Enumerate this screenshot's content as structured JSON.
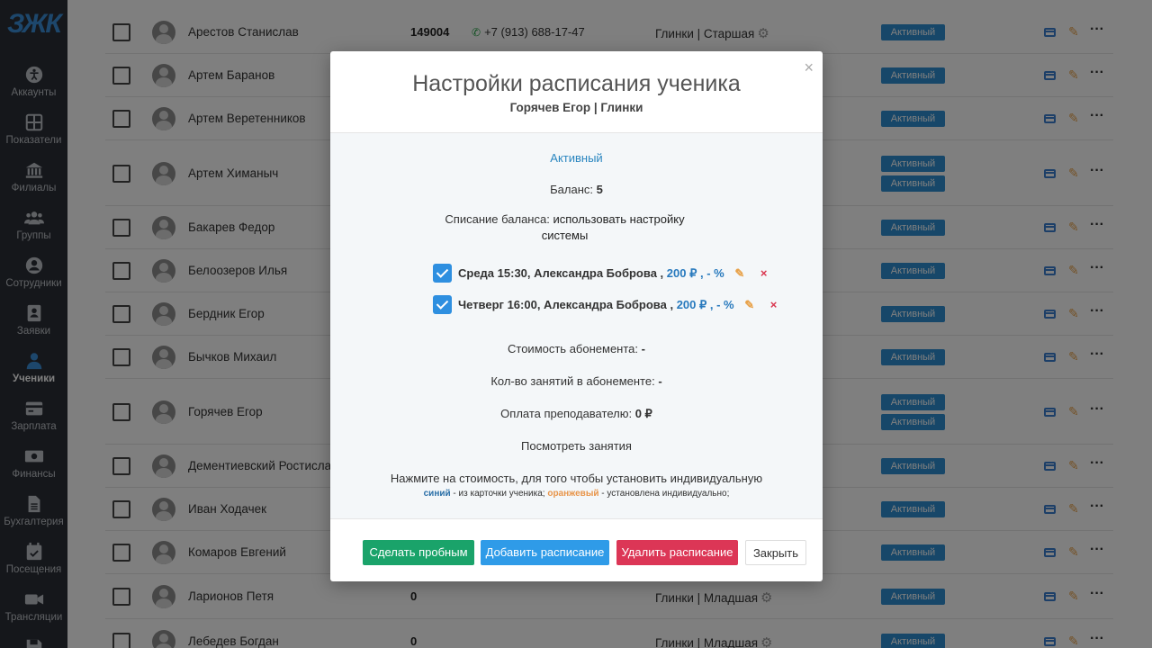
{
  "sidebar": {
    "logo": "ЗЖК",
    "items": [
      {
        "label": "Аккаунты",
        "icon": "accessibility-icon"
      },
      {
        "label": "Показатели",
        "icon": "grid-icon"
      },
      {
        "label": "Филиалы",
        "icon": "bank-icon"
      },
      {
        "label": "Группы",
        "icon": "users-icon"
      },
      {
        "label": "Сотрудники",
        "icon": "user-circle-icon"
      },
      {
        "label": "Заявки",
        "icon": "contact-card-icon"
      },
      {
        "label": "Ученики",
        "icon": "user-icon"
      },
      {
        "label": "Зарплата",
        "icon": "credit-card-icon"
      },
      {
        "label": "Финансы",
        "icon": "money-icon"
      },
      {
        "label": "Бухгалтерия",
        "icon": "document-icon"
      },
      {
        "label": "Посещения",
        "icon": "calendar-check-icon"
      },
      {
        "label": "Трансляции",
        "icon": "video-icon"
      },
      {
        "label": "",
        "icon": "save-icon"
      }
    ]
  },
  "table": {
    "rows": [
      {
        "name": "Арестов Станислав",
        "code": "149004",
        "phone": "+7 (913) 688-17-47",
        "group": "Глинки | Старшая",
        "statuses": [
          "Активный"
        ]
      },
      {
        "name": "Артем Баранов",
        "code": "",
        "phone": "",
        "group": "",
        "statuses": [
          "Активный"
        ]
      },
      {
        "name": "Артем Веретенников",
        "code": "",
        "phone": "",
        "group": "",
        "statuses": [
          "Активный"
        ]
      },
      {
        "name": "Артем Химаныч",
        "code": "",
        "phone": "",
        "group": "",
        "statuses": [
          "Активный",
          "Активный"
        ]
      },
      {
        "name": "Бакарев Федор",
        "code": "",
        "phone": "",
        "group": "",
        "statuses": [
          "Активный"
        ]
      },
      {
        "name": "Белоозеров Илья",
        "code": "",
        "phone": "",
        "group": "",
        "statuses": [
          "Активный"
        ]
      },
      {
        "name": "Бердник Егор",
        "code": "",
        "phone": "",
        "group": "",
        "statuses": [
          "Активный"
        ]
      },
      {
        "name": "Бычков Михаил",
        "code": "",
        "phone": "",
        "group": "",
        "statuses": [
          "Активный"
        ]
      },
      {
        "name": "Горячев Егор",
        "code": "",
        "phone": "",
        "group": "",
        "statuses": [
          "Активный",
          "Активный"
        ]
      },
      {
        "name": "Дементиевский Ростислав",
        "code": "",
        "phone": "",
        "group": "",
        "statuses": [
          "Активный"
        ]
      },
      {
        "name": "Иван Ходачек",
        "code": "",
        "phone": "",
        "group": "",
        "statuses": [
          "Активный"
        ]
      },
      {
        "name": "Комаров Евгений",
        "code": "",
        "phone": "",
        "group": "",
        "statuses": [
          "Активный"
        ]
      },
      {
        "name": "Ларионов Петя",
        "code": "0",
        "phone": "",
        "group": "Глинки | Младшая",
        "statuses": [
          "Активный"
        ]
      },
      {
        "name": "Лебедев Богдан",
        "code": "0",
        "phone": "",
        "group": "Глинки | Младшая",
        "statuses": [
          "Активный"
        ]
      }
    ]
  },
  "modal": {
    "title": "Настройки расписания ученика",
    "subtitle": "Горячев Егор | Глинки",
    "status": "Активный",
    "balance_label": "Баланс:",
    "balance_value": "5",
    "writeoff_label": "Списание баланса:",
    "writeoff_value_1": "использовать настройку",
    "writeoff_value_2": "системы",
    "schedules": [
      {
        "checked": true,
        "text": "Среда 15:30, Александра Боброва ,",
        "price": "200 ₽ , - %"
      },
      {
        "checked": true,
        "text": "Четверг 16:00, Александра Боброва ,",
        "price": "200 ₽ , - %"
      }
    ],
    "subscription_cost_label": "Стоимость абонемента:",
    "subscription_cost_value": "-",
    "lessons_count_label": "Кол-во занятий в абонементе:",
    "lessons_count_value": "-",
    "teacher_pay_label": "Оплата преподавателю:",
    "teacher_pay_value": "0 ₽",
    "view_lessons": "Посмотреть занятия",
    "hint_main": "Нажмите на стоимость, для того чтобы установить индивидуальную",
    "hint_blue": "синий",
    "hint_blue_rest": " - из карточки ученика; ",
    "hint_orange": "оранжевый",
    "hint_orange_rest": " - установлена индивидуально;",
    "buttons": {
      "trial": "Сделать пробным",
      "add": "Добавить расписание",
      "delete": "Удалить расписание",
      "close": "Закрыть"
    },
    "colors": {
      "green": "#1aa36a",
      "blue": "#2f9be8",
      "red": "#dc3656"
    }
  }
}
